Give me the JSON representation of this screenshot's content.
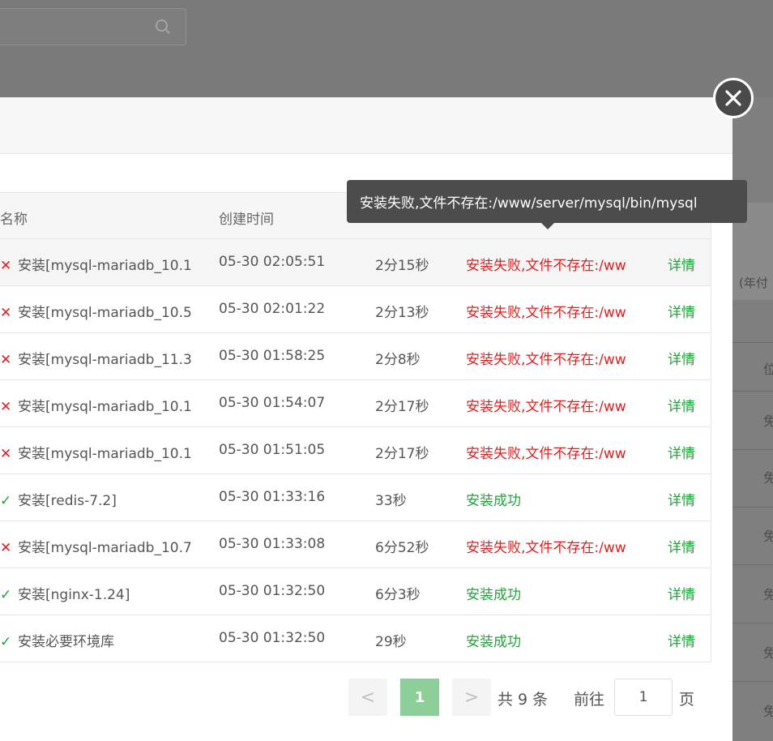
{
  "background": {
    "right_header_text": "(年付",
    "right_column_header": "位",
    "right_cells": [
      "免",
      "免",
      "免",
      "免",
      "免",
      "免"
    ]
  },
  "table": {
    "headers": {
      "name": "名称",
      "created": "创建时间"
    },
    "rows": [
      {
        "status_mark": "✕",
        "ok": false,
        "name": "安装[mysql-mariadb_10.1",
        "time": "05-30 02:05:51",
        "duration": "2分15秒",
        "status": "安装失败,文件不存在:/ww",
        "action": "详情"
      },
      {
        "status_mark": "✕",
        "ok": false,
        "name": "安装[mysql-mariadb_10.5",
        "time": "05-30 02:01:22",
        "duration": "2分13秒",
        "status": "安装失败,文件不存在:/ww",
        "action": "详情"
      },
      {
        "status_mark": "✕",
        "ok": false,
        "name": "安装[mysql-mariadb_11.3",
        "time": "05-30 01:58:25",
        "duration": "2分8秒",
        "status": "安装失败,文件不存在:/ww",
        "action": "详情"
      },
      {
        "status_mark": "✕",
        "ok": false,
        "name": "安装[mysql-mariadb_10.1",
        "time": "05-30 01:54:07",
        "duration": "2分17秒",
        "status": "安装失败,文件不存在:/ww",
        "action": "详情"
      },
      {
        "status_mark": "✕",
        "ok": false,
        "name": "安装[mysql-mariadb_10.1",
        "time": "05-30 01:51:05",
        "duration": "2分17秒",
        "status": "安装失败,文件不存在:/ww",
        "action": "详情"
      },
      {
        "status_mark": "✓",
        "ok": true,
        "name": "安装[redis-7.2]",
        "time": "05-30 01:33:16",
        "duration": "33秒",
        "status": "安装成功",
        "action": "详情"
      },
      {
        "status_mark": "✕",
        "ok": false,
        "name": "安装[mysql-mariadb_10.7",
        "time": "05-30 01:33:08",
        "duration": "6分52秒",
        "status": "安装失败,文件不存在:/ww",
        "action": "详情"
      },
      {
        "status_mark": "✓",
        "ok": true,
        "name": "安装[nginx-1.24]",
        "time": "05-30 01:32:50",
        "duration": "6分3秒",
        "status": "安装成功",
        "action": "详情"
      },
      {
        "status_mark": "✓",
        "ok": true,
        "name": "安装必要环境库",
        "time": "05-30 01:32:50",
        "duration": "29秒",
        "status": "安装成功",
        "action": "详情"
      }
    ]
  },
  "tooltip": {
    "text": "安装失败,文件不存在:/www/server/mysql/bin/mysql"
  },
  "pagination": {
    "prev": "<",
    "current": "1",
    "next": ">",
    "total": "共 9 条",
    "goto_label": "前往",
    "goto_value": "1",
    "page_suffix": "页"
  },
  "colors": {
    "fail": "#e02020",
    "success": "#20a53a",
    "current_page": "#8ccf9a"
  }
}
